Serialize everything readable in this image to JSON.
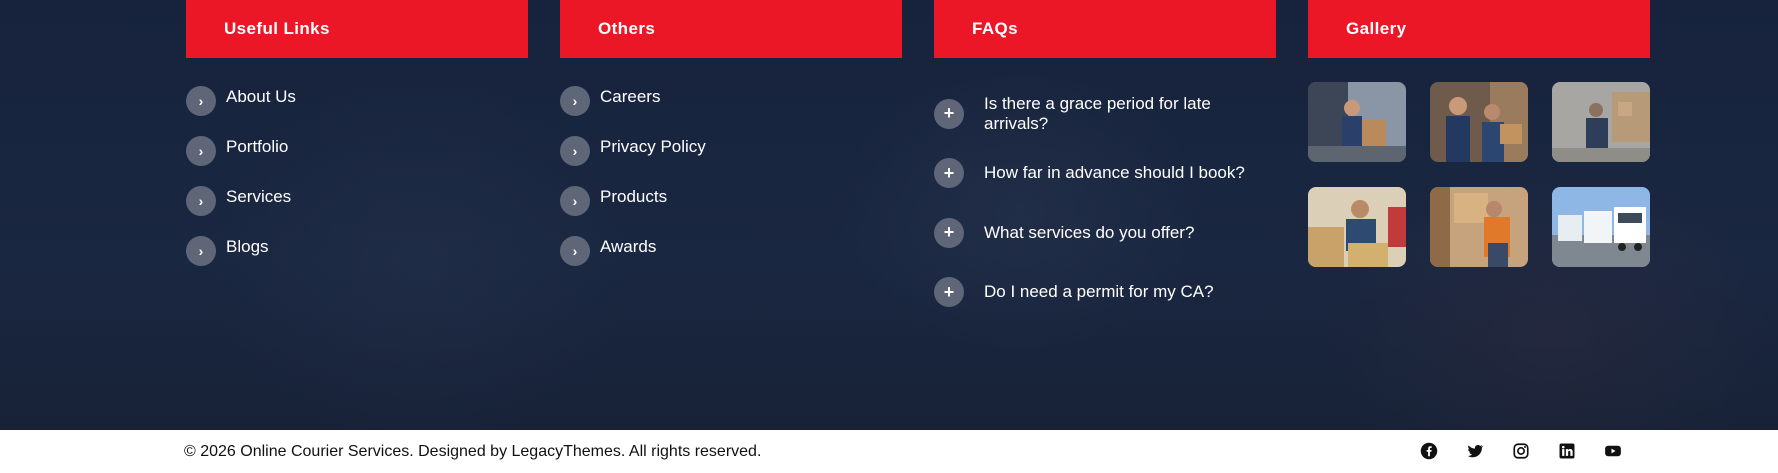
{
  "columns": {
    "useful_links": {
      "title": "Useful Links",
      "items": [
        {
          "label": "About Us"
        },
        {
          "label": "Portfolio"
        },
        {
          "label": "Services"
        },
        {
          "label": "Blogs"
        }
      ]
    },
    "others": {
      "title": "Others",
      "items": [
        {
          "label": "Careers"
        },
        {
          "label": "Privacy Policy"
        },
        {
          "label": "Products"
        },
        {
          "label": "Awards"
        }
      ]
    },
    "faqs": {
      "title": "FAQs",
      "items": [
        {
          "question": "Is there a grace period for late arrivals?"
        },
        {
          "question": "How far in advance should I book?"
        },
        {
          "question": "What services do you offer?"
        },
        {
          "question": "Do I need a permit for my CA?"
        }
      ]
    },
    "gallery": {
      "title": "Gallery",
      "items": [
        {
          "icon": "courier-loading-van-photo"
        },
        {
          "icon": "courier-carrying-boxes-photo"
        },
        {
          "icon": "warehouse-worker-photo"
        },
        {
          "icon": "packing-boxes-photo"
        },
        {
          "icon": "courier-lifting-box-photo"
        },
        {
          "icon": "truck-fleet-photo"
        }
      ]
    }
  },
  "footer": {
    "copyright": "© 2026 Online Courier Services. Designed by LegacyThemes. All rights reserved.",
    "socials": [
      "facebook-icon",
      "twitter-icon",
      "instagram-icon",
      "linkedin-icon",
      "youtube-icon"
    ]
  },
  "colors": {
    "accent": "#eb1727",
    "background": "#16223a",
    "icon_circle": "#5f6678",
    "bottom_bar": "#ffffff"
  },
  "icons": {
    "link_bullet": "›",
    "faq_expand": "+"
  }
}
